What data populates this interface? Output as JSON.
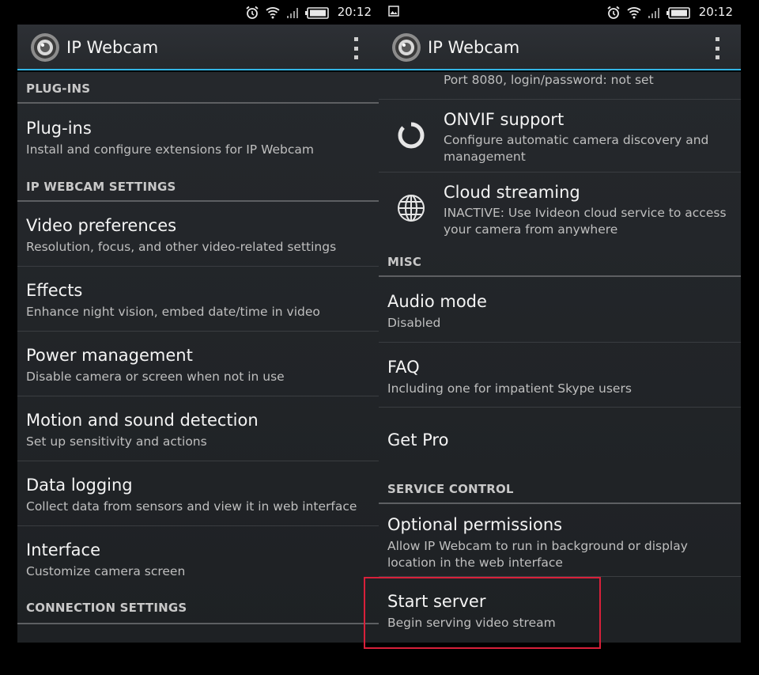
{
  "status_bar": {
    "time": "20:12"
  },
  "app": {
    "title": "IP Webcam"
  },
  "left": {
    "headers": [
      "PLUG-INS",
      "IP WEBCAM SETTINGS",
      "CONNECTION SETTINGS"
    ],
    "items": [
      {
        "title": "Plug-ins",
        "subtitle": "Install and configure extensions for IP Webcam"
      },
      {
        "title": "Video preferences",
        "subtitle": "Resolution, focus, and other video-related settings"
      },
      {
        "title": "Effects",
        "subtitle": "Enhance night vision, embed date/time in video"
      },
      {
        "title": "Power management",
        "subtitle": "Disable camera or screen when not in use"
      },
      {
        "title": "Motion and sound detection",
        "subtitle": "Set up sensitivity and actions"
      },
      {
        "title": "Data logging",
        "subtitle": "Collect data from sensors and view it in web interface"
      },
      {
        "title": "Interface",
        "subtitle": "Customize camera screen"
      }
    ]
  },
  "right": {
    "partial_item": {
      "subtitle": "Port 8080, login/password: not set"
    },
    "icon_items": [
      {
        "title": "ONVIF support",
        "subtitle": "Configure automatic camera discovery and management",
        "icon": "onvif-ring-icon"
      },
      {
        "title": "Cloud streaming",
        "subtitle": "INACTIVE: Use Ivideon cloud service to access your camera from anywhere",
        "icon": "globe-icon"
      }
    ],
    "headers": [
      "MISC",
      "SERVICE CONTROL"
    ],
    "items": [
      {
        "title": "Audio mode",
        "subtitle": "Disabled"
      },
      {
        "title": "FAQ",
        "subtitle": "Including one for impatient Skype users"
      },
      {
        "title": "Get Pro"
      },
      {
        "title": "Optional permissions",
        "subtitle": "Allow IP Webcam to run in background or display location in the web interface"
      },
      {
        "title": "Start server",
        "subtitle": "Begin serving video stream"
      }
    ]
  },
  "colors": {
    "accent": "#33b5e5",
    "highlight": "#d8203a",
    "background": "#25282c"
  }
}
